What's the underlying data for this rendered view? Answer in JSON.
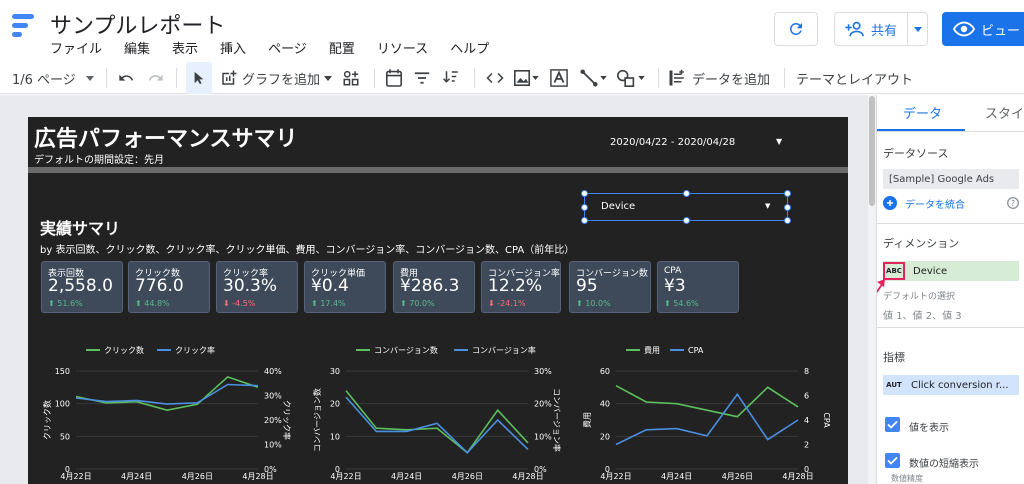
{
  "app": {
    "title": "サンプルレポート",
    "menu": [
      "ファイル",
      "編集",
      "表示",
      "挿入",
      "ページ",
      "配置",
      "リソース",
      "ヘルプ"
    ],
    "share_label": "共有",
    "view_label": "ビュー"
  },
  "toolbar": {
    "page_indicator": "1/6 ページ",
    "add_chart": "グラフを追加",
    "add_data": "データを追加",
    "theme_layout": "テーマとレイアウト"
  },
  "report": {
    "title": "広告パフォーマンスサマリ",
    "subtitle": "デフォルトの期間設定：先月",
    "date_range": "2020/04/22 - 2020/04/28",
    "device_control": "Device",
    "section_title": "実績サマリ",
    "section_sub": "by 表示回数、クリック数、クリック率、クリック単価、費用、コンバージョン率、コンバージョン数、CPA（前年比）",
    "kpis": [
      {
        "label": "表示回数",
        "value": "2,558.0",
        "delta": "⬆ 51.6%",
        "trend": "up"
      },
      {
        "label": "クリック数",
        "value": "776.0",
        "delta": "⬆ 44.8%",
        "trend": "up"
      },
      {
        "label": "クリック率",
        "value": "30.3%",
        "delta": "⬇ -4.5%",
        "trend": "down"
      },
      {
        "label": "クリック単価",
        "value": "¥0.4",
        "delta": "⬆ 17.4%",
        "trend": "up"
      },
      {
        "label": "費用",
        "value": "¥286.3",
        "delta": "⬆ 70.0%",
        "trend": "up"
      },
      {
        "label": "コンバージョン率",
        "value": "12.2%",
        "delta": "⬇ -24.1%",
        "trend": "down"
      },
      {
        "label": "コンバージョン数",
        "value": "95",
        "delta": "⬆ 10.0%",
        "trend": "up"
      },
      {
        "label": "CPA",
        "value": "¥3",
        "delta": "⬆ 54.6%",
        "trend": "up"
      }
    ]
  },
  "panel": {
    "tab_data": "データ",
    "tab_style": "スタイル",
    "datasource_label": "データソース",
    "datasource_value": "[Sample] Google Ads",
    "blend_label": "データを統合",
    "dimension_label": "ディメンション",
    "dimension_type": "ABC",
    "dimension_value": "Device",
    "default_select": "デフォルトの選択",
    "default_values": "値 1、値 2、値 3",
    "metric_label": "指標",
    "metric_type": "AUT",
    "metric_value": "Click conversion r...",
    "show_values": "値を表示",
    "short_numbers": "数値の短縮表示",
    "number_precision": "数値精度"
  },
  "colors": {
    "green": "#5bbf5b",
    "blue": "#4a8fe0",
    "accent": "#1a73e8"
  },
  "chart_data": [
    {
      "type": "line",
      "legend": [
        "クリック数",
        "クリック率"
      ],
      "ylabel_left": "クリック数",
      "ylabel_right": "クリック率",
      "x_ticks": [
        "4月22日",
        "4月24日",
        "4月26日",
        "4月28日"
      ],
      "y_left_ticks": [
        "150",
        "100",
        "50",
        "0"
      ],
      "y_right_ticks": [
        "40%",
        "30%",
        "20%",
        "10%",
        "0%"
      ],
      "ylim_left": [
        0,
        150
      ],
      "ylim_right": [
        0,
        40
      ],
      "series": [
        {
          "name": "クリック数",
          "axis": "left",
          "color": "green",
          "values": [
            111,
            101,
            103,
            90,
            99,
            141,
            125
          ]
        },
        {
          "name": "クリック率",
          "axis": "right",
          "color": "blue",
          "values": [
            29,
            27.5,
            28,
            26.5,
            27,
            34.5,
            34
          ]
        }
      ]
    },
    {
      "type": "line",
      "legend": [
        "コンバージョン数",
        "コンバージョン率"
      ],
      "ylabel_left": "コンバージョン数",
      "ylabel_right": "コンバージョン率",
      "x_ticks": [
        "4月22日",
        "4月24日",
        "4月26日",
        "4月28日"
      ],
      "y_left_ticks": [
        "30",
        "20",
        "10",
        "0"
      ],
      "y_right_ticks": [
        "30%",
        "20%",
        "10%",
        "0%"
      ],
      "ylim_left": [
        0,
        30
      ],
      "ylim_right": [
        0,
        30
      ],
      "series": [
        {
          "name": "コンバージョン数",
          "axis": "left",
          "color": "green",
          "values": [
            24,
            12.5,
            12,
            12.5,
            5,
            18,
            8
          ]
        },
        {
          "name": "コンバージョン率",
          "axis": "right",
          "color": "blue",
          "values": [
            22,
            11.5,
            11.5,
            14,
            5,
            15,
            6
          ]
        }
      ]
    },
    {
      "type": "line",
      "legend": [
        "費用",
        "CPA"
      ],
      "ylabel_left": "費用",
      "ylabel_right": "CPA",
      "x_ticks": [
        "4月22日",
        "4月24日",
        "4月26日",
        "4月28日"
      ],
      "y_left_ticks": [
        "60",
        "40",
        "20",
        "0"
      ],
      "y_right_ticks": [
        "8",
        "6",
        "4",
        "2",
        "0"
      ],
      "ylim_left": [
        0,
        60
      ],
      "ylim_right": [
        0,
        8
      ],
      "series": [
        {
          "name": "費用",
          "axis": "left",
          "color": "green",
          "values": [
            51,
            41,
            40,
            36,
            32,
            50,
            38
          ]
        },
        {
          "name": "CPA",
          "axis": "right",
          "color": "blue",
          "values": [
            2,
            3.2,
            3.3,
            2.7,
            6.1,
            2.4,
            4
          ]
        }
      ]
    }
  ]
}
